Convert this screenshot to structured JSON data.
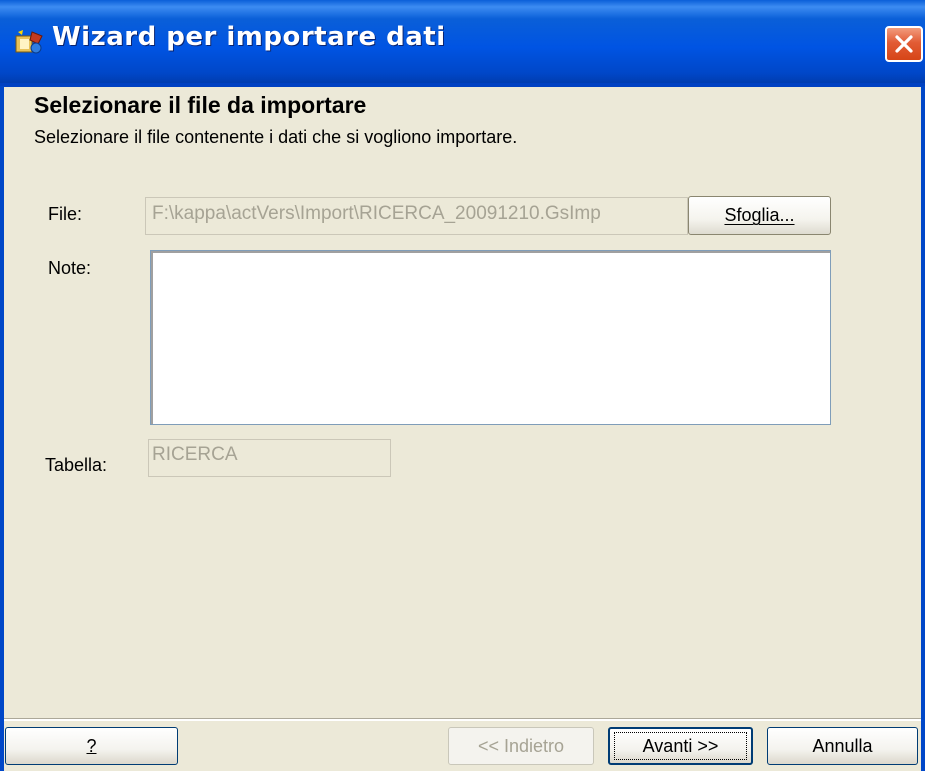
{
  "window": {
    "title": "Wizard per importare dati"
  },
  "header": {
    "heading": "Selezionare il file da importare",
    "subheading": "Selezionare il file contenente i dati che si vogliono importare."
  },
  "form": {
    "file_label": "File:",
    "file_value": "F:\\kappa\\actVers\\Import\\RICERCA_20091210.GsImp",
    "browse_label": "Sfoglia...",
    "note_label": "Note:",
    "note_value": "",
    "table_label": "Tabella:",
    "table_value": "RICERCA"
  },
  "footer": {
    "help_label": "?",
    "back_label": "<< Indietro",
    "next_label": "Avanti >>",
    "cancel_label": "Annulla"
  },
  "colors": {
    "titlebar": "#0054e3",
    "dialog_bg": "#ece9d8",
    "close_button": "#e25c35",
    "disabled_text": "#a6a394"
  },
  "icons": {
    "app": "wizard-icon",
    "close": "close-icon"
  }
}
